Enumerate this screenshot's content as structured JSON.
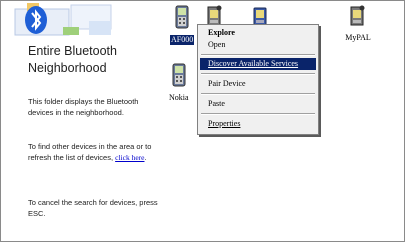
{
  "info_pane": {
    "title": "Entire Bluetooth Neighborhood",
    "paragraph_1": "This folder displays the Bluetooth devices in the neighborhood.",
    "paragraph_2_prefix": "To find other devices in the area or to refresh the list of devices, ",
    "paragraph_2_link": "click here",
    "paragraph_2_suffix": ".",
    "paragraph_3": "To cancel the search for devices, press ESC."
  },
  "devices": [
    {
      "label": "AF000",
      "icon": "phone-icon",
      "selected": true
    },
    {
      "label": "",
      "icon": "pda-icon",
      "selected": false
    },
    {
      "label": "",
      "icon": "pda-icon",
      "selected": false
    },
    {
      "label": "MyPAL",
      "icon": "pda-icon",
      "selected": false
    },
    {
      "label": "Nokia",
      "icon": "phone-icon",
      "selected": false
    }
  ],
  "context_menu": {
    "items": [
      {
        "label": "Explore",
        "bold": true,
        "highlighted": false
      },
      {
        "label": "Open",
        "bold": false,
        "highlighted": false
      },
      {
        "label": "Discover Available Services",
        "bold": false,
        "highlighted": true
      },
      {
        "label": "Pair Device",
        "bold": false,
        "highlighted": false
      },
      {
        "label": "Paste",
        "bold": false,
        "highlighted": false
      },
      {
        "label": "Properties",
        "bold": false,
        "highlighted": false
      }
    ]
  },
  "colors": {
    "selection": "#0a246a",
    "link": "#0000cc",
    "bluetooth_blue": "#1f5fd6",
    "menu_bg": "#f0f0f0"
  }
}
